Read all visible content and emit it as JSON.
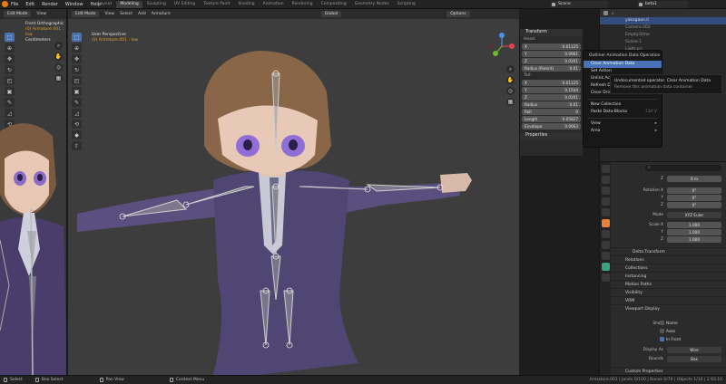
{
  "menubar": {
    "items": [
      "File",
      "Edit",
      "Render",
      "Window",
      "Help"
    ],
    "workspaces": [
      "Layout",
      "Modeling",
      "Sculpting",
      "UV Editing",
      "Texture Paint",
      "Shading",
      "Animation",
      "Rendering",
      "Compositing",
      "Geometry Nodes",
      "Scripting"
    ],
    "active_workspace": "Modeling",
    "scene": "Scene",
    "view_layer": "beta1"
  },
  "left_viewport": {
    "mode": "Edit Mode",
    "view_btn": "View",
    "info_line1": "Front Orthographic",
    "info_line2": "(0) Armature.001 : low",
    "info_line3": "Centimeters"
  },
  "main_viewport": {
    "mode": "Edit Mode",
    "menus": [
      "View",
      "Select",
      "Add",
      "Armature"
    ],
    "orientation": "Global",
    "options_label": "Options",
    "info_line1": "User Perspective",
    "info_line2": "(0) Armature.001 : low"
  },
  "npanel": {
    "title": "Transform",
    "head_label": "Head:",
    "head": [
      {
        "axis": "X",
        "value": "0.01125"
      },
      {
        "axis": "Y",
        "value": "0.0961"
      },
      {
        "axis": "Z",
        "value": "0.0201"
      }
    ],
    "radius_parent_label": "Radius (Parent)",
    "radius_parent_value": "0.01",
    "tail_label": "Tail:",
    "tail": [
      {
        "axis": "X",
        "value": "0.01125"
      },
      {
        "axis": "Y",
        "value": "0.1544"
      },
      {
        "axis": "Z",
        "value": "0.0201"
      }
    ],
    "roll_label": "Radius",
    "roll_value": "0.01",
    "roll2_label": "Roll",
    "roll2_value": "0",
    "length_label": "Length",
    "length_value": "0.05827",
    "envelope_label": "Envelope",
    "envelope_value": "0.0063",
    "properties_label": "Properties"
  },
  "context_menu": {
    "title": "Outliner Animation Data Operation",
    "items": [
      {
        "label": "Clear Animation Data",
        "highlight": true,
        "shortcut": ""
      },
      {
        "label": "Set Action",
        "highlight": false,
        "shortcut": ""
      },
      {
        "label": "Unlink Action",
        "highlight": false,
        "shortcut": ""
      },
      {
        "label": "Refresh Drivers",
        "highlight": false,
        "shortcut": ""
      },
      {
        "label": "Clear Drivers",
        "highlight": false,
        "shortcut": ""
      }
    ],
    "items2": [
      {
        "label": "New Collection",
        "shortcut": ""
      },
      {
        "label": "Paste Data-Blocks",
        "shortcut": "Ctrl V"
      }
    ],
    "submenus": [
      "View",
      "Area"
    ]
  },
  "tooltip": {
    "line1": "Outliner Animation Data Operation",
    "line2": "Undocumented operator. Clear Animation Data",
    "line3": "Remove this animation data container"
  },
  "outliner": {
    "top_item": "yakogaon.ll",
    "rows": [
      "Camera.002",
      "Empty.0/me",
      "Scene.1",
      "Light.pri"
    ]
  },
  "properties": {
    "search_placeholder": "",
    "z_label": "Z",
    "z_value": "0 m",
    "rotation_label": "Rotation X",
    "rotation": [
      "0°",
      "0°",
      "0°"
    ],
    "rot_axes": [
      "X",
      "Y",
      "Z"
    ],
    "mode_label": "Mode",
    "mode_value": "XYZ Euler",
    "scale_label": "Scale X",
    "scale": [
      "1.000",
      "1.000",
      "1.000"
    ],
    "delta_label": "Delta Transform",
    "sections": [
      "Relations",
      "Collections",
      "Instancing",
      "Motion Paths",
      "Visibility",
      "VRM",
      "Viewport Display"
    ],
    "show_label": "Show",
    "show_options": [
      {
        "label": "Name",
        "on": false
      },
      {
        "label": "Axes",
        "on": false
      },
      {
        "label": "In Front",
        "on": true
      }
    ],
    "display_as_label": "Display As",
    "display_as_value": "Wire",
    "bounds_label": "Bounds",
    "bounds_value": "Box",
    "custom_props": "Custom Properties"
  },
  "statusbar": {
    "select": "Select",
    "box_select": "Box Select",
    "pan_view": "Pan View",
    "context_menu": "Context Menu",
    "stats": "Armature.001 | Joints 0/100 | Bones 0/70 | Objects 1/10 | 2.93.10"
  }
}
